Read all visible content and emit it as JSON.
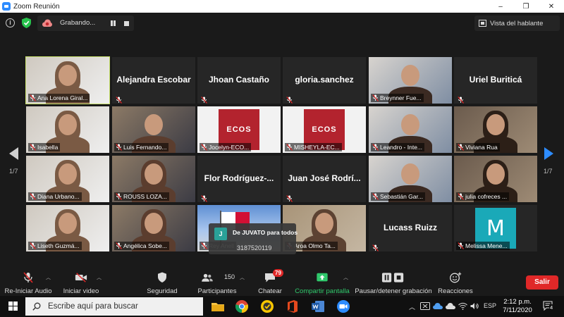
{
  "window": {
    "title": "Zoom Reunión",
    "minimize": "–",
    "restore": "❐",
    "close": "✕"
  },
  "topbar": {
    "recording_label": "Grabando...",
    "view_button": "Vista del hablante"
  },
  "pagination": {
    "left_page": "1/7",
    "right_page": "1/7"
  },
  "participants": [
    {
      "label": "Ana Lorena Giral...",
      "name_only": "",
      "video": "woman"
    },
    {
      "label": "",
      "name_only": "Alejandra Escobar",
      "video": "none"
    },
    {
      "label": "",
      "name_only": "Jhoan Castaño",
      "video": "none"
    },
    {
      "label": "",
      "name_only": "gloria.sanchez",
      "video": "none"
    },
    {
      "label": "Breynner Fue...",
      "name_only": "",
      "video": "man"
    },
    {
      "label": "",
      "name_only": "Uriel Buriticá",
      "video": "none"
    },
    {
      "label": "Isabella",
      "name_only": "",
      "video": "woman"
    },
    {
      "label": "Luis Fernando...",
      "name_only": "",
      "video": "man"
    },
    {
      "label": "Jocelyn-ECO...",
      "name_only": "",
      "video": "ecos"
    },
    {
      "label": "MISHEYLA-EC...",
      "name_only": "",
      "video": "ecos"
    },
    {
      "label": "Leandro - Inte...",
      "name_only": "",
      "video": "man"
    },
    {
      "label": "Viviana Rua",
      "name_only": "",
      "video": "woman"
    },
    {
      "label": "Diana Urbano...",
      "name_only": "",
      "video": "woman"
    },
    {
      "label": "ROUSS LOZA...",
      "name_only": "",
      "video": "woman"
    },
    {
      "label": "",
      "name_only": "Flor Rodríguez-...",
      "video": "none"
    },
    {
      "label": "",
      "name_only": "Juan José Rodrí...",
      "video": "none"
    },
    {
      "label": "Sebastián Gar...",
      "name_only": "",
      "video": "man"
    },
    {
      "label": "julia cofreces ...",
      "name_only": "",
      "video": "woman"
    },
    {
      "label": "Liseth Guzmá...",
      "name_only": "",
      "video": "woman"
    },
    {
      "label": "Angélica Sobe...",
      "name_only": "",
      "video": "woman"
    },
    {
      "label": "Rey Anell",
      "name_only": "",
      "video": "flag"
    },
    {
      "label": "Aroa Olmo Ta...",
      "name_only": "",
      "video": "woman"
    },
    {
      "label": "",
      "name_only": "Lucass Ruizz",
      "video": "none"
    },
    {
      "label": "Melissa Mene...",
      "name_only": "",
      "video": "mlogo"
    }
  ],
  "tile_texts": {
    "ecos_logo": "ECOS",
    "m_logo": "M"
  },
  "chat_notification": {
    "avatar_letter": "J",
    "from": "De JUVATO para todos",
    "message": "3187520119"
  },
  "toolbar": {
    "audio": "Re-Iniciar Audio",
    "video": "Iniciar video",
    "security": "Seguridad",
    "participants": "Participantes",
    "participants_count": "150",
    "chat": "Chatear",
    "chat_badge": "79",
    "share": "Compartir pantalla",
    "recording": "Pausar/detener grabación",
    "reactions": "Reacciones",
    "leave": "Salir"
  },
  "taskbar": {
    "search_placeholder": "Escribe aquí para buscar",
    "language": "ESP",
    "time": "2:12 p.m.",
    "date": "7/11/2020",
    "notifications_count": "4"
  },
  "colors": {
    "accent": "#2d8cff",
    "active_speaker": "#c7e06b",
    "share_green": "#2fc86b",
    "leave_red": "#e02828"
  }
}
